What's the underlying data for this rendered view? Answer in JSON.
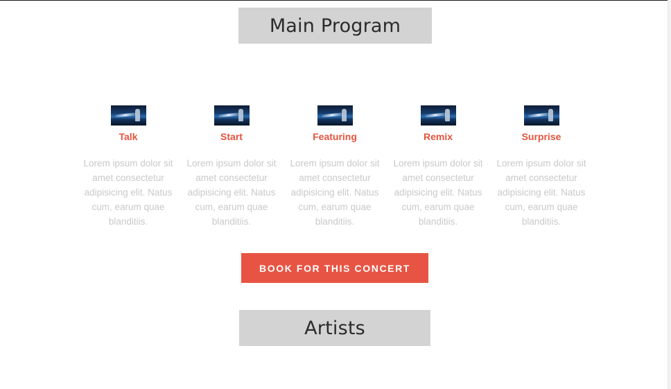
{
  "main_program": {
    "title": "Main Program",
    "items": [
      {
        "title": "Talk",
        "description": "Lorem ipsum dolor sit amet consectetur adipisicing elit. Natus cum, earum quae blanditiis."
      },
      {
        "title": "Start",
        "description": "Lorem ipsum dolor sit amet consectetur adipisicing elit. Natus cum, earum quae blanditiis."
      },
      {
        "title": "Featuring",
        "description": "Lorem ipsum dolor sit amet consectetur adipisicing elit. Natus cum, earum quae blanditiis."
      },
      {
        "title": "Remix",
        "description": "Lorem ipsum dolor sit amet consectetur adipisicing elit. Natus cum, earum quae blanditiis."
      },
      {
        "title": "Surprise",
        "description": "Lorem ipsum dolor sit amet consectetur adipisicing elit. Natus cum, earum quae blanditiis."
      }
    ],
    "book_button": "BOOK FOR THIS CONCERT"
  },
  "artists": {
    "title": "Artists"
  },
  "colors": {
    "accent": "#e85443",
    "item_title": "#e5533d",
    "title_background": "#d3d3d3",
    "muted_text": "#c9c9c9"
  }
}
